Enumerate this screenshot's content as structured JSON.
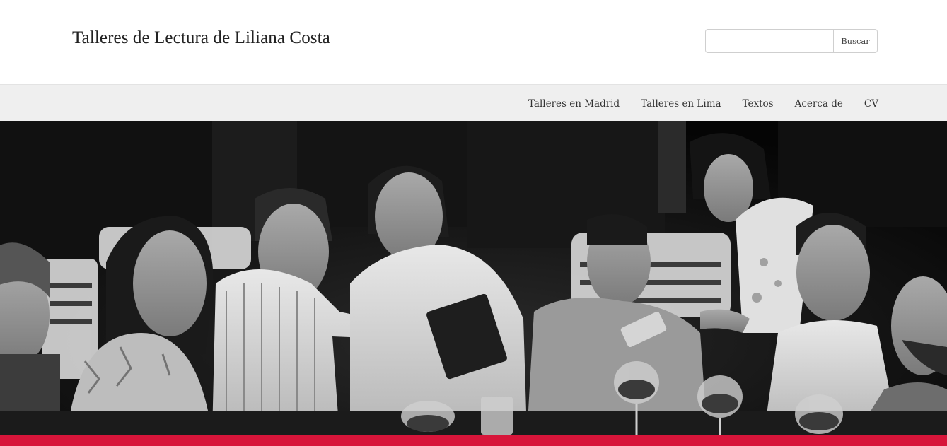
{
  "header": {
    "site_title": "Talleres de Lectura de Liliana Costa",
    "search": {
      "value": "",
      "placeholder": "",
      "button_label": "Buscar"
    }
  },
  "nav": {
    "items": [
      {
        "label": "Talleres en Madrid"
      },
      {
        "label": "Talleres en Lima"
      },
      {
        "label": "Textos"
      },
      {
        "label": "Acerca de"
      },
      {
        "label": "CV"
      }
    ]
  },
  "hero": {
    "image": "black-and-white-reading-group-photo",
    "tone": "grayscale"
  },
  "colors": {
    "nav_background": "#efefef",
    "accent_bar": "#d7153a",
    "text": "#222222"
  }
}
